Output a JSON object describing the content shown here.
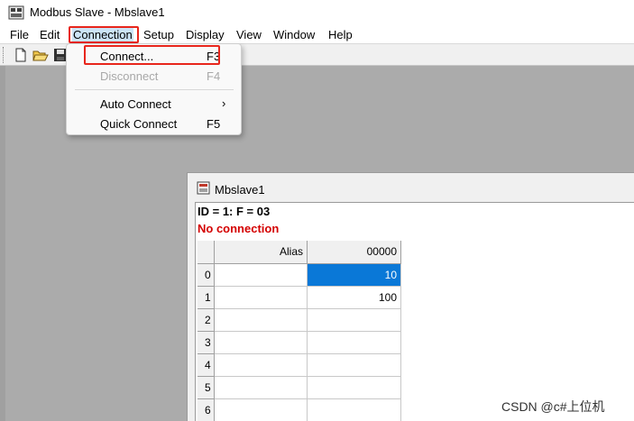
{
  "window": {
    "title": "Modbus Slave - Mbslave1"
  },
  "menubar": {
    "items": [
      "File",
      "Edit",
      "Connection",
      "Setup",
      "Display",
      "View",
      "Window",
      "Help"
    ],
    "active": "Connection"
  },
  "connection_menu": {
    "items": [
      {
        "label": "Connect...",
        "shortcut": "F3",
        "enabled": true,
        "highlighted": true
      },
      {
        "label": "Disconnect",
        "shortcut": "F4",
        "enabled": false
      },
      {
        "label": "Auto Connect",
        "shortcut": "",
        "submenu": true,
        "enabled": true
      },
      {
        "label": "Quick Connect",
        "shortcut": "F5",
        "enabled": true
      }
    ]
  },
  "child_window": {
    "title": "Mbslave1",
    "id_line": "ID = 1: F = 03",
    "status": "No connection",
    "columns": [
      "Alias",
      "00000"
    ],
    "rows": [
      {
        "index": "0",
        "alias": "",
        "value": "10",
        "selected": true
      },
      {
        "index": "1",
        "alias": "",
        "value": "100"
      },
      {
        "index": "2",
        "alias": "",
        "value": ""
      },
      {
        "index": "3",
        "alias": "",
        "value": ""
      },
      {
        "index": "4",
        "alias": "",
        "value": ""
      },
      {
        "index": "5",
        "alias": "",
        "value": ""
      },
      {
        "index": "6",
        "alias": "",
        "value": ""
      }
    ]
  },
  "watermark": "CSDN @c#上位机",
  "colors": {
    "highlight_box": "#e8261c",
    "selection": "#0a78d7",
    "status_red": "#d40000"
  }
}
